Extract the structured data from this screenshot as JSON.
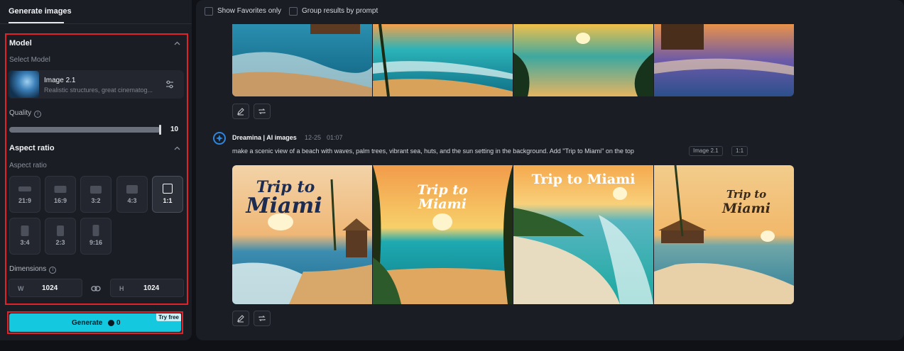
{
  "left_panel": {
    "tab_label": "Generate images",
    "model": {
      "section_title": "Model",
      "select_label": "Select Model",
      "name": "Image 2.1",
      "description": "Realistic structures, great cinematog..."
    },
    "quality": {
      "label": "Quality",
      "value": "10",
      "level_fraction": 1.0
    },
    "aspect_ratio": {
      "section_title": "Aspect ratio",
      "sub_label": "Aspect ratio",
      "options": [
        "21:9",
        "16:9",
        "3:2",
        "4:3",
        "1:1",
        "3:4",
        "2:3",
        "9:16"
      ],
      "selected": "1:1"
    },
    "dimensions": {
      "label": "Dimensions",
      "width_letter": "W",
      "width": "1024",
      "height_letter": "H",
      "height": "1024"
    },
    "generate": {
      "label": "Generate",
      "credits": "0",
      "badge": "Try free"
    }
  },
  "main": {
    "filters": {
      "favorites": "Show Favorites only",
      "group": "Group results by prompt"
    },
    "entry": {
      "author": "Dreamina | AI images",
      "date": "12-25",
      "time": "01:07",
      "prompt": "make a scenic view of a beach with waves, palm trees, vibrant sea, huts, and the sun setting in the background. Add \"Trip to Miami\" on the top",
      "model_tag": "Image 2.1",
      "ratio_tag": "1:1"
    },
    "overlay_texts": {
      "img1_line1": "Trip to",
      "img1_line2": "Miami",
      "img2_line1": "Trip to",
      "img2_line2": "Miami",
      "img3": "Trip to Miami",
      "img4_line1": "Trip to",
      "img4_line2": "Miami"
    }
  },
  "colors": {
    "accent": "#14c8e0",
    "highlight_border": "#e0222b",
    "panel": "#1a1d24",
    "background": "#0f1116"
  }
}
